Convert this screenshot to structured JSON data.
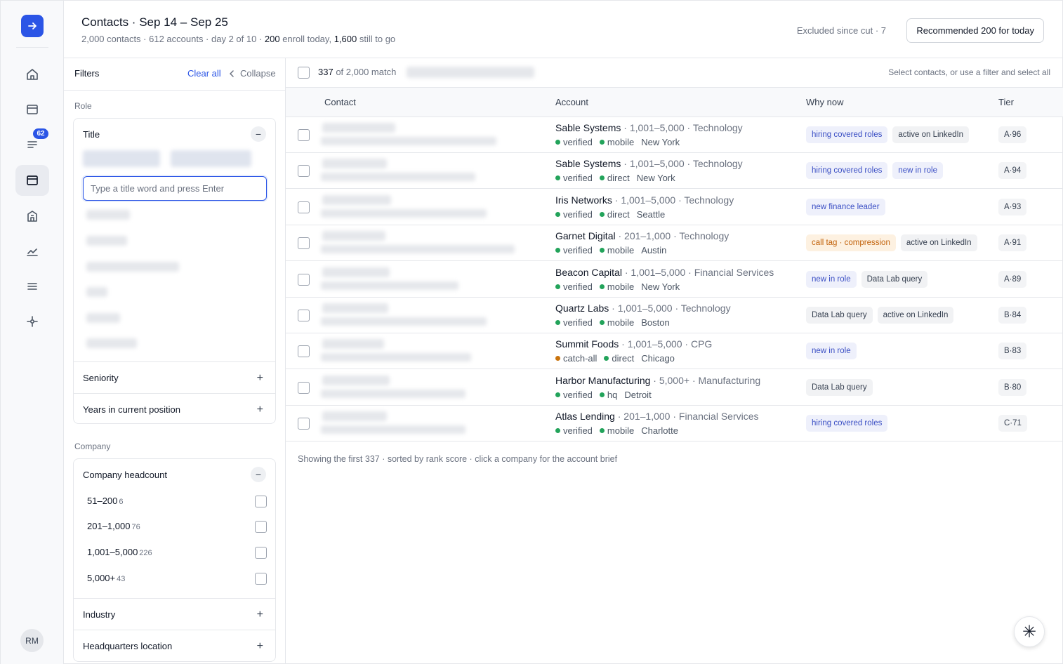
{
  "rail": {
    "logo_icon": "arrow-right-icon",
    "items": [
      {
        "icon": "home-icon"
      },
      {
        "icon": "inbox-icon"
      },
      {
        "icon": "list-text-icon",
        "badge": "62"
      },
      {
        "icon": "contacts-icon",
        "active": true
      },
      {
        "icon": "building-icon"
      },
      {
        "icon": "chart-line-icon"
      },
      {
        "icon": "menu-icon"
      },
      {
        "icon": "settings-node-icon"
      }
    ],
    "avatar": "RM"
  },
  "header": {
    "title": "Contacts · Sep 14 – Sep 25",
    "sub_a": "2,000 contacts · 612 accounts · day 2 of 10 · ",
    "sub_enroll": "200",
    "sub_b": " enroll today, ",
    "sub_togo": "1,600",
    "sub_c": " still to go",
    "excluded": "Excluded since cut · 7",
    "recommend_button": "Recommended 200 for today"
  },
  "filters": {
    "title": "Filters",
    "clear_all": "Clear all",
    "collapse": "Collapse",
    "role_label": "Role",
    "title_filter": "Title",
    "title_placeholder": "Type a title word and press Enter",
    "seniority": "Seniority",
    "years": "Years in current position",
    "company_label": "Company",
    "headcount": "Company headcount",
    "headcount_options": [
      {
        "label": "51–200",
        "count": "6"
      },
      {
        "label": "201–1,000",
        "count": "76"
      },
      {
        "label": "1,001–5,000",
        "count": "226"
      },
      {
        "label": "5,000+",
        "count": "43"
      }
    ],
    "industry": "Industry",
    "hq": "Headquarters location"
  },
  "table": {
    "match_count": "337",
    "match_rest": " of 2,000 match",
    "select_hint": "Select contacts, or use a filter and select all",
    "columns": {
      "contact": "Contact",
      "account": "Account",
      "why": "Why now",
      "tier": "Tier"
    },
    "rows": [
      {
        "account": "Sable Systems",
        "meta": " · 1,001–5,000 · Technology",
        "email": "verified",
        "email_color": "#22a35a",
        "phone": "mobile",
        "city": "New York",
        "tags": [
          {
            "t": "hiring covered roles",
            "c": "blue"
          },
          {
            "t": "active on LinkedIn",
            "c": "gray"
          }
        ],
        "tier": "A·96"
      },
      {
        "account": "Sable Systems",
        "meta": " · 1,001–5,000 · Technology",
        "email": "verified",
        "email_color": "#22a35a",
        "phone": "direct",
        "city": "New York",
        "tags": [
          {
            "t": "hiring covered roles",
            "c": "blue"
          },
          {
            "t": "new in role",
            "c": "blue"
          }
        ],
        "tier": "A·94"
      },
      {
        "account": "Iris Networks",
        "meta": " · 1,001–5,000 · Technology",
        "email": "verified",
        "email_color": "#22a35a",
        "phone": "direct",
        "city": "Seattle",
        "tags": [
          {
            "t": "new finance leader",
            "c": "blue"
          }
        ],
        "tier": "A·93"
      },
      {
        "account": "Garnet Digital",
        "meta": " · 201–1,000 · Technology",
        "email": "verified",
        "email_color": "#22a35a",
        "phone": "mobile",
        "city": "Austin",
        "tags": [
          {
            "t": "call tag · compression",
            "c": "orange"
          },
          {
            "t": "active on LinkedIn",
            "c": "gray"
          }
        ],
        "tier": "A·91"
      },
      {
        "account": "Beacon Capital",
        "meta": " · 1,001–5,000 · Financial Services",
        "email": "verified",
        "email_color": "#22a35a",
        "phone": "mobile",
        "city": "New York",
        "tags": [
          {
            "t": "new in role",
            "c": "blue"
          },
          {
            "t": "Data Lab query",
            "c": "gray"
          }
        ],
        "tier": "A·89"
      },
      {
        "account": "Quartz Labs",
        "meta": " · 1,001–5,000 · Technology",
        "email": "verified",
        "email_color": "#22a35a",
        "phone": "mobile",
        "city": "Boston",
        "tags": [
          {
            "t": "Data Lab query",
            "c": "gray"
          },
          {
            "t": "active on LinkedIn",
            "c": "gray"
          }
        ],
        "tier": "B·84"
      },
      {
        "account": "Summit Foods",
        "meta": " · 1,001–5,000 · CPG",
        "email": "catch-all",
        "email_color": "#c9730d",
        "phone": "direct",
        "city": "Chicago",
        "tags": [
          {
            "t": "new in role",
            "c": "blue"
          }
        ],
        "tier": "B·83"
      },
      {
        "account": "Harbor Manufacturing",
        "meta": " · 5,000+ · Manufacturing",
        "email": "verified",
        "email_color": "#22a35a",
        "phone": "hq",
        "city": "Detroit",
        "tags": [
          {
            "t": "Data Lab query",
            "c": "gray"
          }
        ],
        "tier": "B·80"
      },
      {
        "account": "Atlas Lending",
        "meta": " · 201–1,000 · Financial Services",
        "email": "verified",
        "email_color": "#22a35a",
        "phone": "mobile",
        "city": "Charlotte",
        "tags": [
          {
            "t": "hiring covered roles",
            "c": "blue"
          }
        ],
        "tier": "C·71"
      }
    ],
    "footer": "Showing the first 337 · sorted by rank score · click a company for the account brief"
  },
  "fab_icon": "asterisk-icon"
}
